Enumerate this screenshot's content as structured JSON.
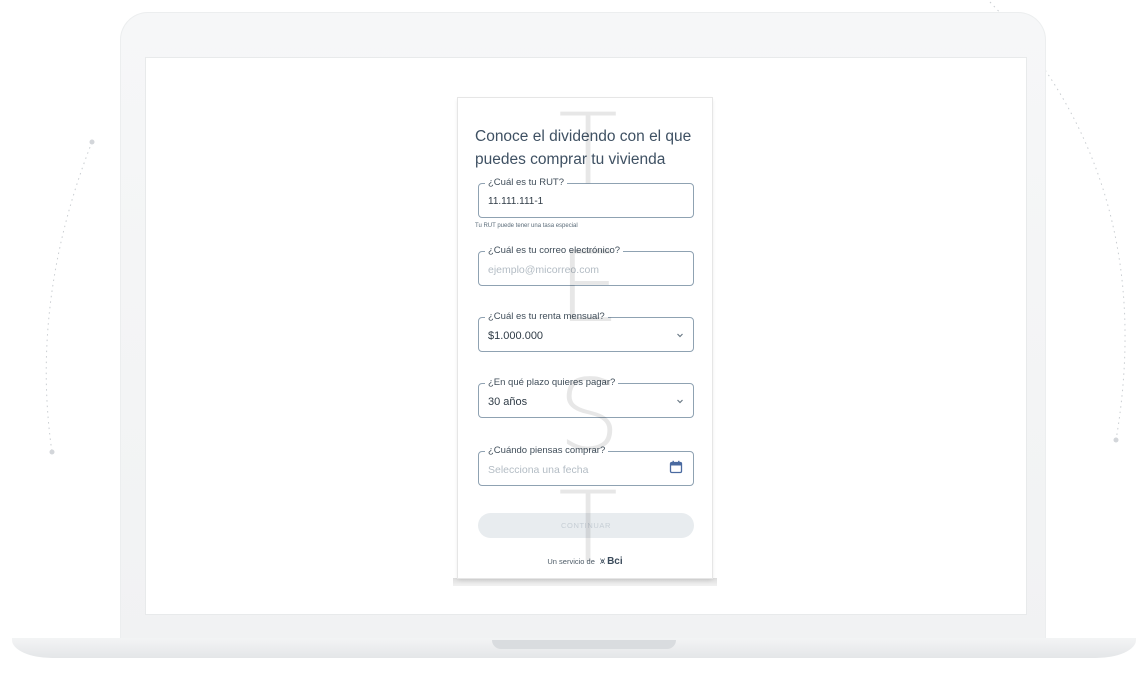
{
  "form": {
    "title": "Conoce el dividendo con el que puedes comprar tu vivienda",
    "rut": {
      "label": "¿Cuál es tu RUT?",
      "value": "11.111.111-1",
      "helper": "Tu RUT puede tener una tasa especial"
    },
    "email": {
      "label": "¿Cuál es tu correo electrónico?",
      "placeholder": "ejemplo@micorreo.com"
    },
    "income": {
      "label": "¿Cuál es tu renta mensual?",
      "value": "$1.000.000"
    },
    "term": {
      "label": "¿En qué plazo quieres pagar?",
      "value": "30 años"
    },
    "purchase_date": {
      "label": "¿Cuándo piensas comprar?",
      "placeholder": "Selecciona una fecha"
    },
    "continue_label": "CONTINUAR",
    "footer_text": "Un servicio de",
    "brand": "Bci"
  },
  "watermark": [
    "T",
    "E",
    "S",
    "T"
  ],
  "icons": {
    "income_dropdown": "chevron-down-icon",
    "term_dropdown": "chevron-down-icon",
    "date_picker": "calendar-icon"
  },
  "colors": {
    "accent": "#4a6aa0",
    "text": "#3f5163",
    "border": "#8fa2b2",
    "button_disabled": "#e8ecef"
  }
}
